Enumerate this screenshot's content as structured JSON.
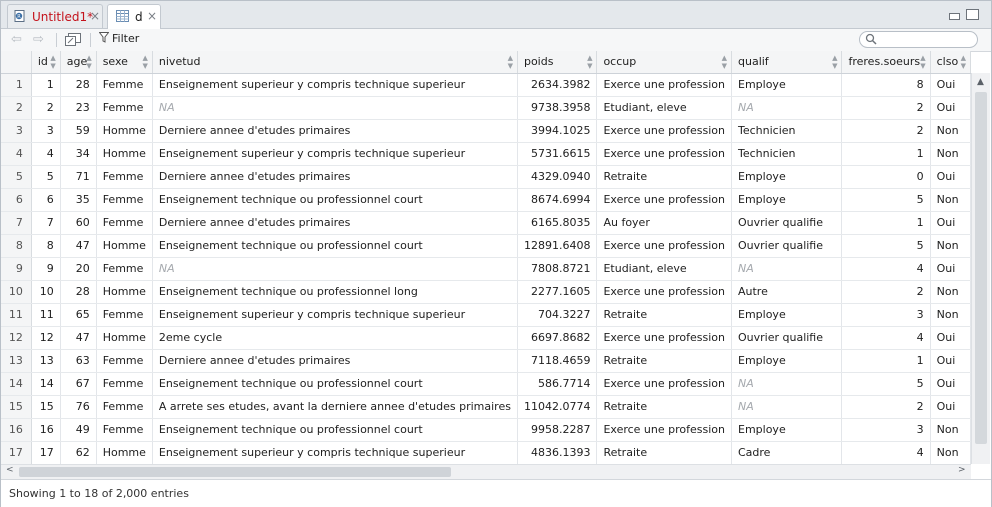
{
  "tabs": [
    {
      "label": "Untitled1*",
      "color": "#c4121b",
      "icon": "r-script-icon",
      "close": "×"
    },
    {
      "label": "d",
      "color": "#1e1e1e",
      "icon": "data-table-icon",
      "close": "×"
    }
  ],
  "toolbar": {
    "filter_label": "Filter",
    "search_placeholder": ""
  },
  "columns": [
    "",
    "id",
    "age",
    "sexe",
    "nivetud",
    "poids",
    "occup",
    "qualif",
    "freres.soeurs",
    "clso"
  ],
  "rows": [
    [
      "1",
      "1",
      "28",
      "Femme",
      "Enseignement superieur y compris technique superieur",
      "2634.3982",
      "Exerce une profession",
      "Employe",
      "8",
      "Oui"
    ],
    [
      "2",
      "2",
      "23",
      "Femme",
      "NA",
      "9738.3958",
      "Etudiant, eleve",
      "NA",
      "2",
      "Oui"
    ],
    [
      "3",
      "3",
      "59",
      "Homme",
      "Derniere annee d'etudes primaires",
      "3994.1025",
      "Exerce une profession",
      "Technicien",
      "2",
      "Non"
    ],
    [
      "4",
      "4",
      "34",
      "Homme",
      "Enseignement superieur y compris technique superieur",
      "5731.6615",
      "Exerce une profession",
      "Technicien",
      "1",
      "Non"
    ],
    [
      "5",
      "5",
      "71",
      "Femme",
      "Derniere annee d'etudes primaires",
      "4329.0940",
      "Retraite",
      "Employe",
      "0",
      "Oui"
    ],
    [
      "6",
      "6",
      "35",
      "Femme",
      "Enseignement technique ou professionnel court",
      "8674.6994",
      "Exerce une profession",
      "Employe",
      "5",
      "Non"
    ],
    [
      "7",
      "7",
      "60",
      "Femme",
      "Derniere annee d'etudes primaires",
      "6165.8035",
      "Au foyer",
      "Ouvrier qualifie",
      "1",
      "Oui"
    ],
    [
      "8",
      "8",
      "47",
      "Homme",
      "Enseignement technique ou professionnel court",
      "12891.6408",
      "Exerce une profession",
      "Ouvrier qualifie",
      "5",
      "Non"
    ],
    [
      "9",
      "9",
      "20",
      "Femme",
      "NA",
      "7808.8721",
      "Etudiant, eleve",
      "NA",
      "4",
      "Oui"
    ],
    [
      "10",
      "10",
      "28",
      "Homme",
      "Enseignement technique ou professionnel long",
      "2277.1605",
      "Exerce une profession",
      "Autre",
      "2",
      "Non"
    ],
    [
      "11",
      "11",
      "65",
      "Femme",
      "Enseignement superieur y compris technique superieur",
      "704.3227",
      "Retraite",
      "Employe",
      "3",
      "Non"
    ],
    [
      "12",
      "12",
      "47",
      "Homme",
      "2eme cycle",
      "6697.8682",
      "Exerce une profession",
      "Ouvrier qualifie",
      "4",
      "Oui"
    ],
    [
      "13",
      "13",
      "63",
      "Femme",
      "Derniere annee d'etudes primaires",
      "7118.4659",
      "Retraite",
      "Employe",
      "1",
      "Oui"
    ],
    [
      "14",
      "14",
      "67",
      "Femme",
      "Enseignement technique ou professionnel court",
      "586.7714",
      "Exerce une profession",
      "NA",
      "5",
      "Oui"
    ],
    [
      "15",
      "15",
      "76",
      "Femme",
      "A arrete ses etudes, avant la derniere annee d'etudes primaires",
      "11042.0774",
      "Retraite",
      "NA",
      "2",
      "Oui"
    ],
    [
      "16",
      "16",
      "49",
      "Femme",
      "Enseignement technique ou professionnel court",
      "9958.2287",
      "Exerce une profession",
      "Employe",
      "3",
      "Non"
    ],
    [
      "17",
      "17",
      "62",
      "Homme",
      "Enseignement superieur y compris technique superieur",
      "4836.1393",
      "Retraite",
      "Cadre",
      "4",
      "Non"
    ]
  ],
  "status_text": "Showing 1 to 18 of 2,000 entries"
}
